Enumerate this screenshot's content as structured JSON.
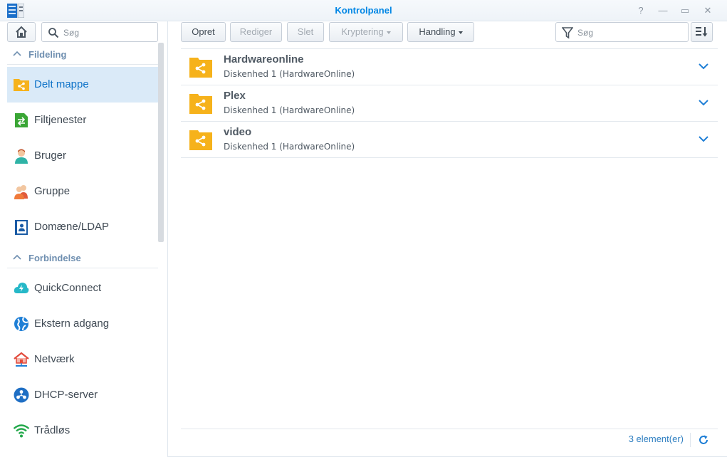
{
  "window": {
    "title": "Kontrolpanel",
    "help_glyph": "?",
    "minimize_glyph": "—",
    "maximize_glyph": "▭",
    "close_glyph": "✕"
  },
  "sidebar": {
    "search_placeholder": "Søg",
    "groups": [
      {
        "label": "Fildeling",
        "items": [
          {
            "label": "Delt mappe",
            "icon": "shared-folder-icon",
            "active": true
          },
          {
            "label": "Filtjenester",
            "icon": "file-services-icon"
          },
          {
            "label": "Bruger",
            "icon": "user-icon"
          },
          {
            "label": "Gruppe",
            "icon": "group-icon"
          },
          {
            "label": "Domæne/LDAP",
            "icon": "domain-ldap-icon"
          }
        ]
      },
      {
        "label": "Forbindelse",
        "items": [
          {
            "label": "QuickConnect",
            "icon": "quickconnect-icon"
          },
          {
            "label": "Ekstern adgang",
            "icon": "external-access-icon"
          },
          {
            "label": "Netværk",
            "icon": "network-icon"
          },
          {
            "label": "DHCP-server",
            "icon": "dhcp-server-icon"
          },
          {
            "label": "Trådløs",
            "icon": "wireless-icon"
          }
        ]
      }
    ]
  },
  "toolbar": {
    "create_label": "Opret",
    "edit_label": "Rediger",
    "delete_label": "Slet",
    "encryption_label": "Kryptering",
    "action_label": "Handling",
    "search_placeholder": "Søg"
  },
  "shares": [
    {
      "name": "Hardwareonline",
      "location": "Diskenhed 1 (HardwareOnline)"
    },
    {
      "name": "Plex",
      "location": "Diskenhed 1 (HardwareOnline)"
    },
    {
      "name": "video",
      "location": "Diskenhed 1 (HardwareOnline)"
    }
  ],
  "footer": {
    "count_label": "3 element(er)"
  },
  "colors": {
    "accent": "#0086e5",
    "active_bg": "#daeaf8",
    "folder": "#f6b21b"
  }
}
